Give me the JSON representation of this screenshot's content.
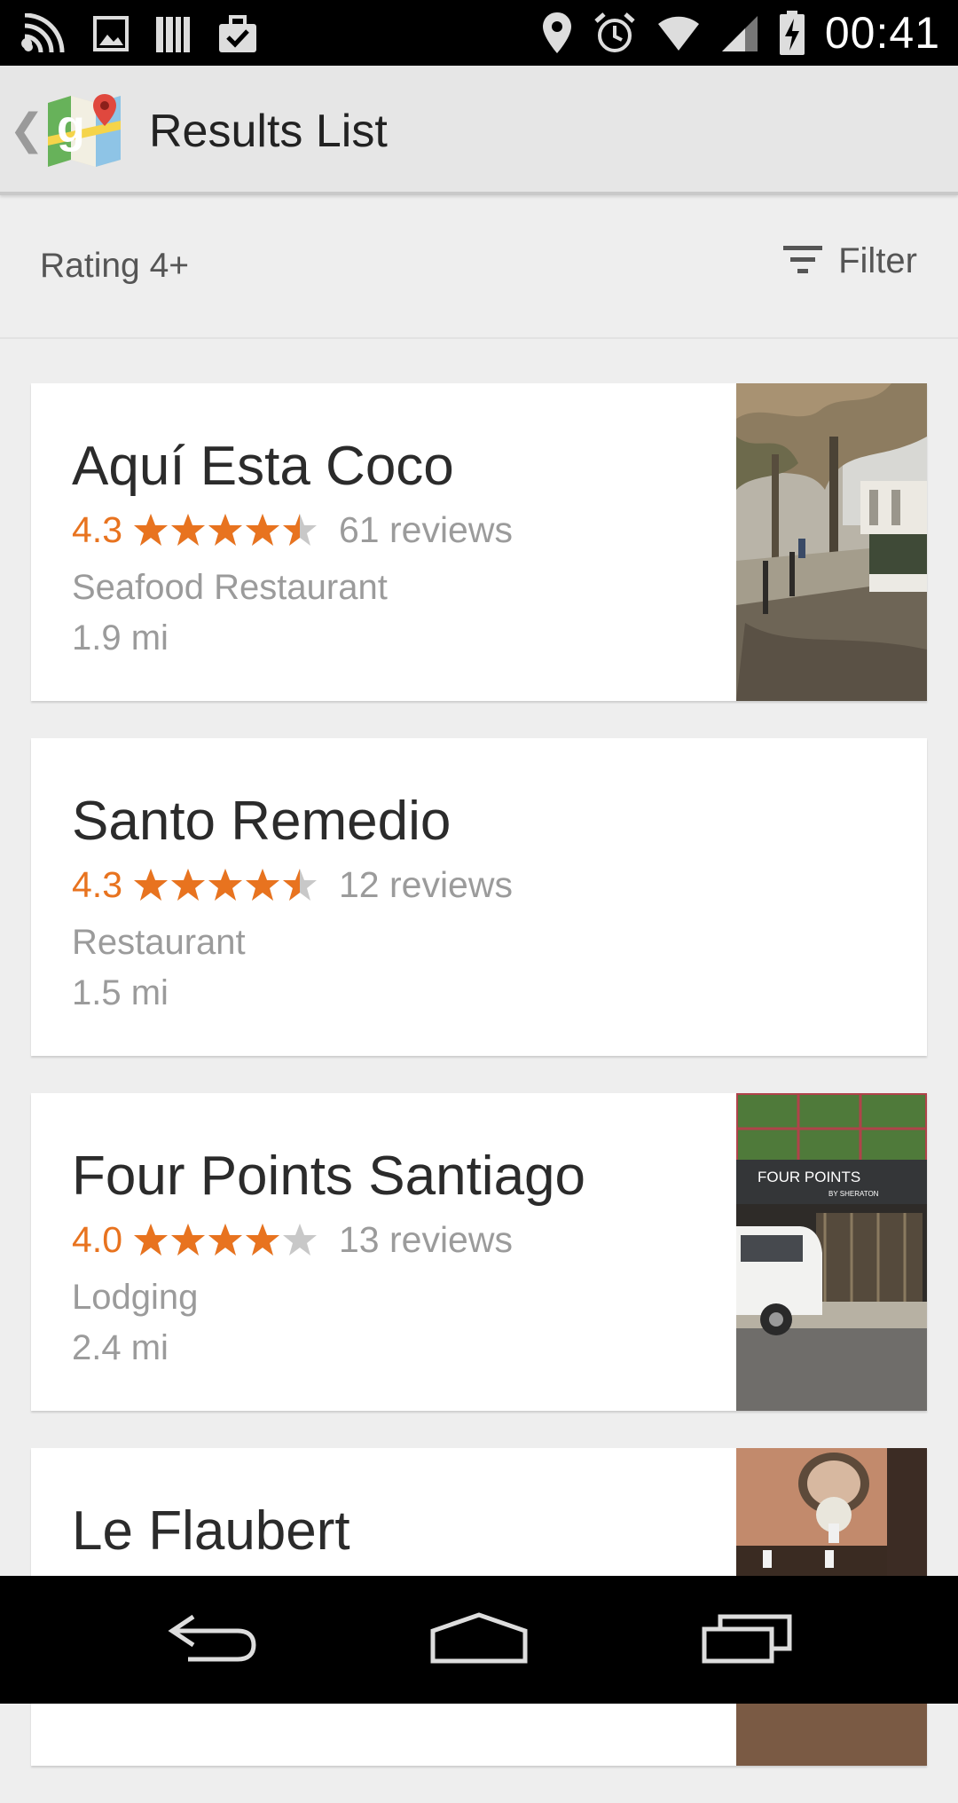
{
  "status_bar": {
    "time": "00:41",
    "left_icons": [
      "wifi-signal-icon",
      "image-icon",
      "books-icon",
      "briefcase-check-icon"
    ],
    "right_icons": [
      "location-pin-icon",
      "alarm-icon",
      "wifi-icon",
      "cell-signal-icon",
      "battery-charging-icon"
    ]
  },
  "action_bar": {
    "title": "Results List",
    "up_glyph": "❮",
    "logo_icon": "google-maps-logo"
  },
  "filter_bar": {
    "rating_filter": "Rating 4+",
    "filter_label": "Filter",
    "filter_icon": "filter-lines-icon"
  },
  "results": [
    {
      "name": "Aquí Esta Coco",
      "rating": "4.3",
      "stars_value": 4.5,
      "reviews": "61 reviews",
      "category": "Seafood Restaurant",
      "distance": "1.9 mi",
      "has_photo": true,
      "photo": "street-trees-photo"
    },
    {
      "name": "Santo Remedio",
      "rating": "4.3",
      "stars_value": 4.5,
      "reviews": "12 reviews",
      "category": "Restaurant",
      "distance": "1.5 mi",
      "has_photo": false
    },
    {
      "name": "Four Points Santiago",
      "rating": "4.0",
      "stars_value": 4,
      "reviews": "13 reviews",
      "category": "Lodging",
      "distance": "2.4 mi",
      "has_photo": true,
      "photo": "hotel-front-photo",
      "photo_sign": "FOUR POINTS",
      "photo_sign_sub": "BY SHERATON"
    },
    {
      "name": "Le Flaubert",
      "has_photo": true,
      "photo": "restaurant-interior-photo"
    }
  ],
  "nav_bar": {
    "buttons": [
      "back-nav-icon",
      "home-nav-icon",
      "recents-nav-icon"
    ]
  },
  "colors": {
    "accent_orange": "#e8731f",
    "star_empty": "#c8c8c8",
    "status_bar": "#000000",
    "background": "#eeeeee"
  }
}
